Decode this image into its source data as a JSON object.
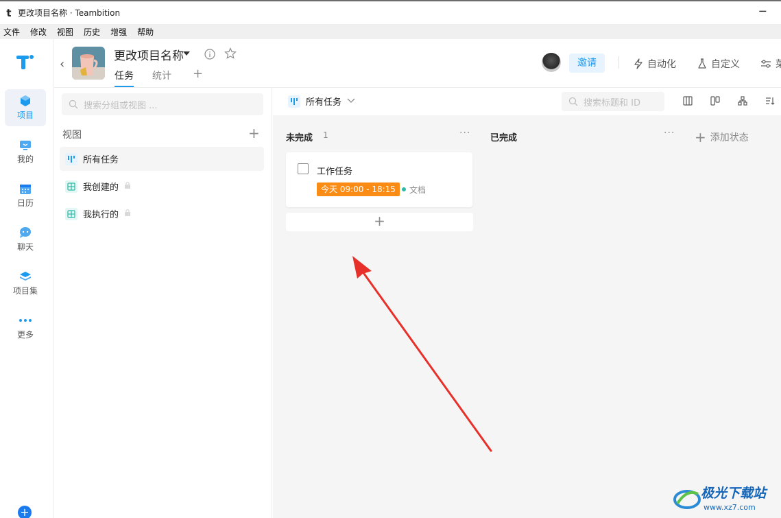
{
  "window": {
    "title": "更改项目名称 · Teambition",
    "app_logo": "t",
    "minimize": "─"
  },
  "menu": [
    "文件",
    "修改",
    "视图",
    "历史",
    "增强",
    "帮助"
  ],
  "nav": {
    "items": [
      {
        "label": "项目",
        "icon": "cube-icon",
        "active": true
      },
      {
        "label": "我的",
        "icon": "monitor-icon"
      },
      {
        "label": "日历",
        "icon": "calendar-icon"
      },
      {
        "label": "聊天",
        "icon": "chat-icon"
      },
      {
        "label": "项目集",
        "icon": "layers-icon"
      },
      {
        "label": "更多",
        "icon": "more-dots-icon"
      }
    ],
    "bottom_button": "+"
  },
  "header": {
    "back": "‹",
    "project_name": "更改项目名称",
    "tabs": [
      {
        "label": "任务",
        "active": true
      },
      {
        "label": "统计"
      }
    ],
    "tab_add": "+",
    "invite": "邀请",
    "actions": [
      {
        "label": "自动化",
        "icon": "lightning-icon"
      },
      {
        "label": "自定义",
        "icon": "flask-icon"
      },
      {
        "label": "菜",
        "icon": "settings-sliders-icon"
      }
    ]
  },
  "sidebar": {
    "search_placeholder": "搜索分组或视图 ...",
    "views_title": "视图",
    "views_add": "+",
    "items": [
      {
        "label": "所有任务",
        "icon": "board-view-icon",
        "active": true
      },
      {
        "label": "我创建的",
        "icon": "table-view-icon",
        "locked": true
      },
      {
        "label": "我执行的",
        "icon": "table-view-icon",
        "locked": true
      }
    ]
  },
  "toolbar": {
    "current_view": "所有任务",
    "search_placeholder": "搜索标题和 ID"
  },
  "board": {
    "columns": [
      {
        "title": "未完成",
        "count": "1",
        "more": "···"
      },
      {
        "title": "已完成",
        "more": "···"
      }
    ],
    "add_status": "添加状态",
    "task": {
      "title": "工作任务",
      "time": "今天 09:00 - 18:15",
      "tag": "文档"
    },
    "add_task": "+"
  },
  "colors": {
    "accent": "#1b9aee",
    "time_badge": "#fa8c16",
    "tag_dot": "#2eb8a6",
    "arrow": "#e8302a"
  },
  "watermark": {
    "title": "极光下载站",
    "url": "www.xz7.com"
  }
}
